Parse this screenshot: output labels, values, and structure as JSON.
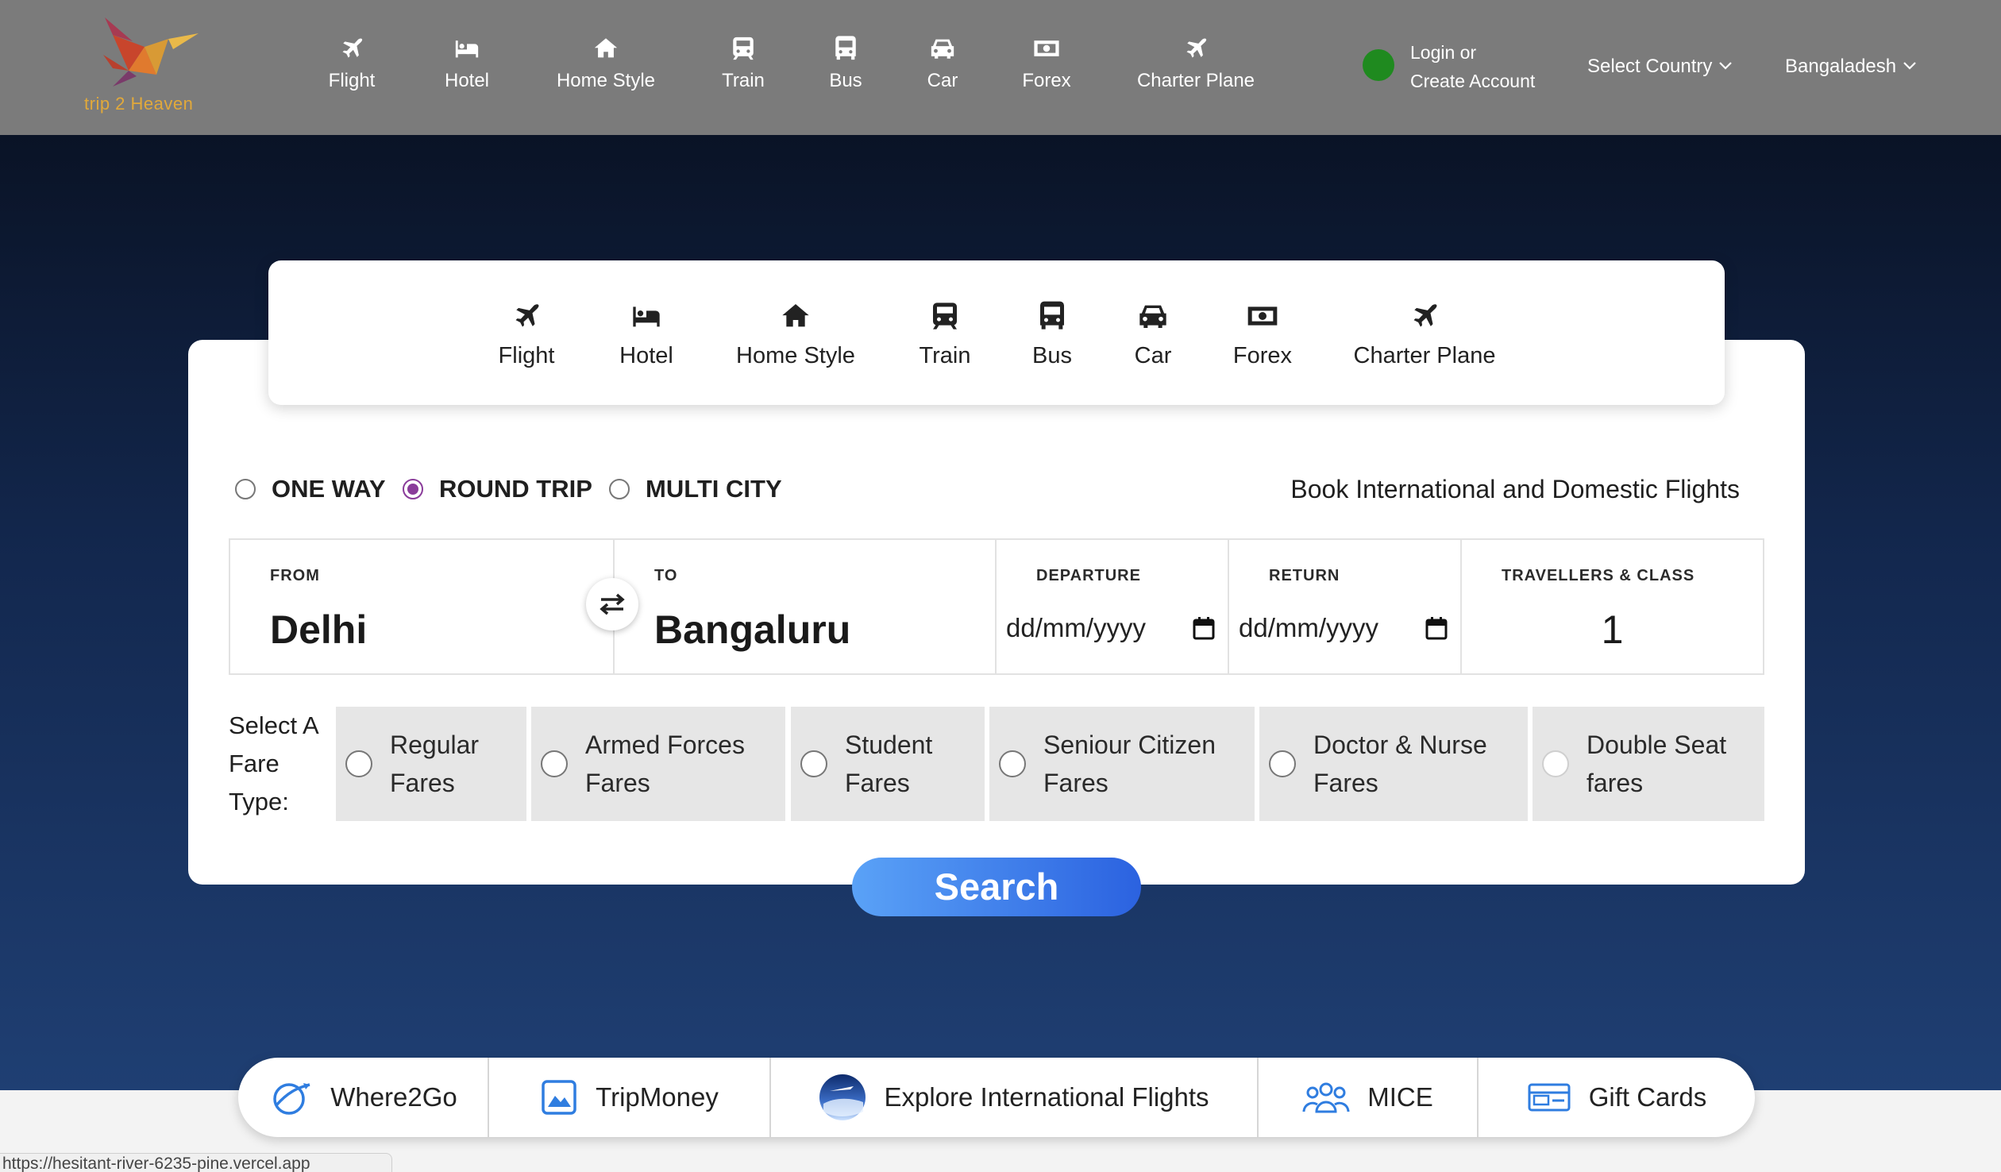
{
  "header": {
    "logo_text": "trip 2 Heaven",
    "nav": [
      {
        "label": "Flight",
        "icon": "plane-icon"
      },
      {
        "label": "Hotel",
        "icon": "bed-icon"
      },
      {
        "label": "Home Style",
        "icon": "home-icon"
      },
      {
        "label": "Train",
        "icon": "train-icon"
      },
      {
        "label": "Bus",
        "icon": "bus-icon"
      },
      {
        "label": "Car",
        "icon": "car-icon"
      },
      {
        "label": "Forex",
        "icon": "money-icon"
      },
      {
        "label": "Charter Plane",
        "icon": "plane-icon"
      }
    ],
    "login_line1": "Login or",
    "login_line2": "Create Account",
    "country_select": "Select Country",
    "selected_country": "Bangaladesh"
  },
  "booking": {
    "tabs": [
      {
        "label": "Flight",
        "icon": "plane-icon"
      },
      {
        "label": "Hotel",
        "icon": "bed-icon"
      },
      {
        "label": "Home Style",
        "icon": "home-icon"
      },
      {
        "label": "Train",
        "icon": "train-icon"
      },
      {
        "label": "Bus",
        "icon": "bus-icon"
      },
      {
        "label": "Car",
        "icon": "car-icon"
      },
      {
        "label": "Forex",
        "icon": "money-icon"
      },
      {
        "label": "Charter Plane",
        "icon": "plane-icon"
      }
    ],
    "trip_types": [
      {
        "label": "ONE WAY",
        "selected": false
      },
      {
        "label": "ROUND TRIP",
        "selected": true
      },
      {
        "label": "MULTI CITY",
        "selected": false
      }
    ],
    "title": "Book International and Domestic Flights",
    "from_label": "FROM",
    "from_value": "Delhi",
    "to_label": "TO",
    "to_value": "Bangaluru",
    "departure_label": "DEPARTURE",
    "departure_placeholder": "dd/mm/yyyy",
    "return_label": "RETURN",
    "return_placeholder": "dd/mm/yyyy",
    "travellers_label": "TRAVELLERS & CLASS",
    "travellers_value": "1",
    "fare_label_line1": "Select A",
    "fare_label_line2": "Fare",
    "fare_label_line3": "Type:",
    "fares": [
      {
        "line1": "Regular",
        "line2": "Fares"
      },
      {
        "line1": "Armed Forces",
        "line2": "Fares"
      },
      {
        "line1": "Student",
        "line2": "Fares"
      },
      {
        "line1": "Seniour Citizen",
        "line2": "Fares"
      },
      {
        "line1": "Doctor & Nurse",
        "line2": "Fares"
      },
      {
        "line1": "Double Seat",
        "line2": "fares"
      }
    ],
    "search_label": "Search",
    "accent_color": "#8a3c9a",
    "button_color": "#3a78ec"
  },
  "bottom_bar": [
    {
      "label": "Where2Go",
      "icon": "globe-plane-icon"
    },
    {
      "label": "TripMoney",
      "icon": "image-icon"
    },
    {
      "label": "Explore International Flights",
      "icon": "earth-icon"
    },
    {
      "label": "MICE",
      "icon": "group-icon"
    },
    {
      "label": "Gift Cards",
      "icon": "gift-card-icon"
    }
  ],
  "status_url": "https://hesitant-river-6235-pine.vercel.app"
}
